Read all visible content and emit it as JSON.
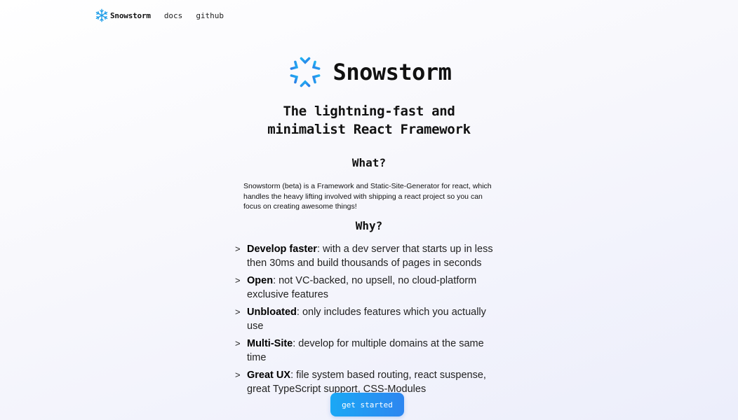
{
  "nav": {
    "brand": "Snowstorm",
    "links": [
      "docs",
      "github"
    ]
  },
  "hero": {
    "title": "Snowstorm",
    "tagline_line1": "The lightning-fast and",
    "tagline_line2": "minimalist React Framework"
  },
  "what": {
    "heading": "What?",
    "text": "Snowstorm (beta) is a Framework and Static-Site-Generator for react, which handles the heavy lifting involved with shipping a react project so you can focus on creating awesome things!"
  },
  "why": {
    "heading": "Why?",
    "bullet_symbol": ">",
    "items": [
      {
        "title": "Develop faster",
        "text": ": with a dev server that starts up in less then 30ms and build thousands of pages in seconds"
      },
      {
        "title": "Open",
        "text": ": not VC-backed, no upsell, no cloud-platform exclusive features"
      },
      {
        "title": "Unbloated",
        "text": ": only includes features which you actually use"
      },
      {
        "title": "Multi-Site",
        "text": ": develop for multiple domains at the same time"
      },
      {
        "title": "Great UX",
        "text": ": file system based routing, react suspense, great TypeScript support, CSS-Modules"
      }
    ]
  },
  "cta": {
    "label": "get started"
  },
  "colors": {
    "snowflake": "#1e9de8",
    "button_start": "#1aa8f5",
    "button_end": "#2d86f0"
  },
  "icons": {
    "logo": "snowflake-icon"
  }
}
